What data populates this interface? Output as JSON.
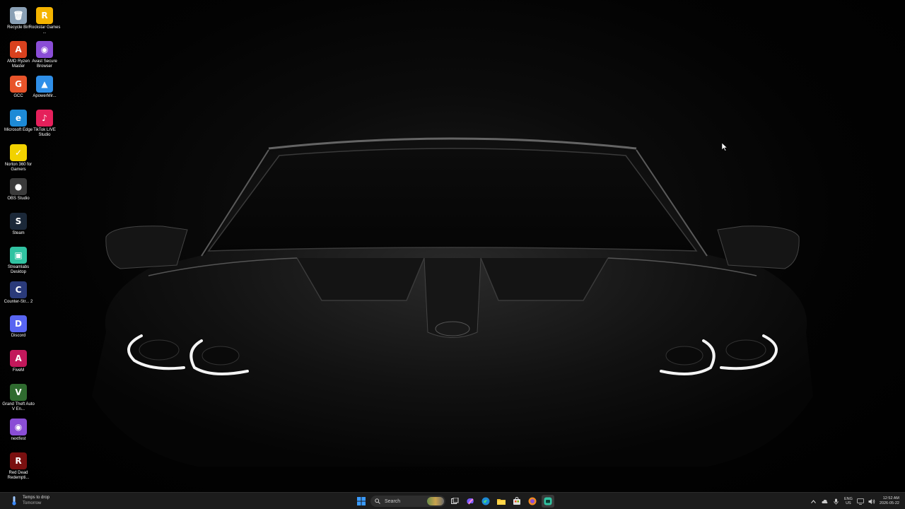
{
  "desktop": {
    "icons": [
      {
        "label": "Recycle Bin",
        "icon": "recycle-bin-icon",
        "color": "#8aa0b5",
        "glyph": "🗑"
      },
      {
        "label": "Rockstar Games ...",
        "icon": "rockstar-icon",
        "color": "#f5b400",
        "glyph": "R"
      },
      {
        "label": "AMD Ryzen Master",
        "icon": "amd-ryzen-icon",
        "color": "#d9411e",
        "glyph": "A"
      },
      {
        "label": "Avast Secure Browser",
        "icon": "avast-browser-icon",
        "color": "#8a4dd6",
        "glyph": "◉"
      },
      {
        "label": "GCC",
        "icon": "gcc-icon",
        "color": "#e8542a",
        "glyph": "G"
      },
      {
        "label": "ApowerMir...",
        "icon": "apowermirror-icon",
        "color": "#2f8fe8",
        "glyph": "▲"
      },
      {
        "label": "Microsoft Edge",
        "icon": "edge-icon",
        "color": "#1d8ad6",
        "glyph": "e"
      },
      {
        "label": "TikTok LIVE Studio",
        "icon": "tiktok-live-icon",
        "color": "#e5205b",
        "glyph": "♪"
      },
      {
        "label": "Norton 360 for Gamers",
        "icon": "norton-icon",
        "color": "#f2d200",
        "glyph": "✓"
      },
      {
        "label": "OBS Studio",
        "icon": "obs-icon",
        "color": "#3a3a3a",
        "glyph": "●"
      },
      {
        "label": "Steam",
        "icon": "steam-icon",
        "color": "#1b2838",
        "glyph": "S"
      },
      {
        "label": "Streamlabs Desktop",
        "icon": "streamlabs-icon",
        "color": "#31c3a2",
        "glyph": "▣"
      },
      {
        "label": "Counter-Str... 2",
        "icon": "counter-strike-icon",
        "color": "#2a3a7a",
        "glyph": "C"
      },
      {
        "label": "Discord",
        "icon": "discord-icon",
        "color": "#5865f2",
        "glyph": "D"
      },
      {
        "label": "FiveM",
        "icon": "fivem-icon",
        "color": "#c2185b",
        "glyph": "A"
      },
      {
        "label": "Grand Theft Auto V En...",
        "icon": "gta-icon",
        "color": "#2f6b2f",
        "glyph": "V"
      },
      {
        "label": "nextfest",
        "icon": "nextfest-icon",
        "color": "#8a4dd6",
        "glyph": "◉"
      },
      {
        "label": "Red Dead Redempti...",
        "icon": "red-dead-icon",
        "color": "#7a1010",
        "glyph": "R"
      }
    ]
  },
  "taskbar": {
    "weather": {
      "line1": "Temps to drop",
      "line2": "Tomorrow"
    },
    "search": {
      "placeholder": "Search"
    },
    "pinned": [
      {
        "name": "start-button",
        "icon": "windows-logo-icon"
      },
      {
        "name": "task-view-button",
        "icon": "task-view-icon"
      },
      {
        "name": "copilot-button",
        "icon": "copilot-icon"
      },
      {
        "name": "taskbar-edge-button",
        "icon": "edge-icon"
      },
      {
        "name": "taskbar-file-explorer-button",
        "icon": "folder-icon"
      },
      {
        "name": "taskbar-store-button",
        "icon": "store-icon"
      },
      {
        "name": "taskbar-avast-button",
        "icon": "avast-browser-icon"
      },
      {
        "name": "taskbar-streamlabs-button",
        "icon": "streamlabs-icon"
      }
    ],
    "tray": {
      "lang_line1": "ENG",
      "lang_line2": "US",
      "time": "12:52 AM",
      "date": "2026-05-22"
    }
  }
}
